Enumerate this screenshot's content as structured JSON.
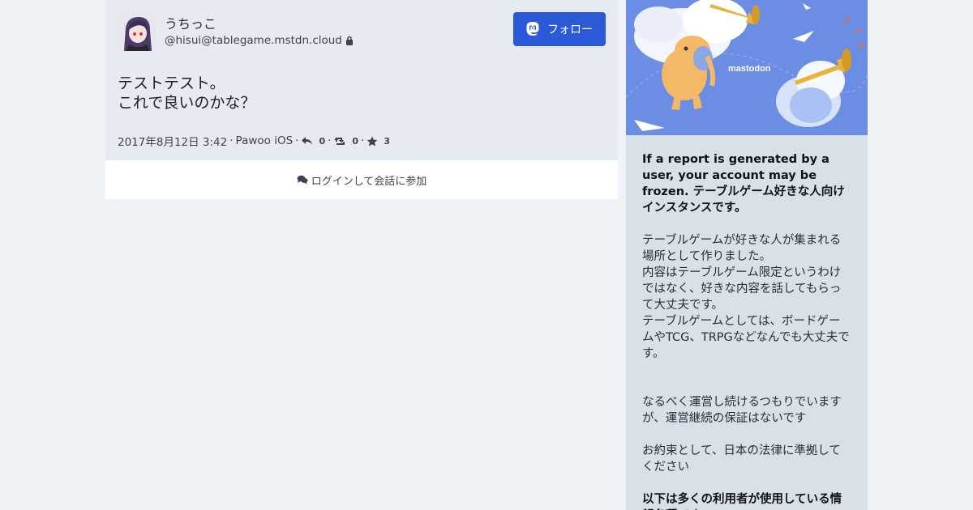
{
  "status": {
    "display_name": "うちっこ",
    "acct": "@hisui@tablegame.mstdn.cloud",
    "follow_label": "フォロー",
    "content_lines": [
      "テストテスト。",
      "これで良いのかな？"
    ],
    "date": "2017年8月12日 3:42",
    "application": "Pawoo iOS",
    "replies": "0",
    "reblogs": "0",
    "favourites": "3",
    "separator": "·"
  },
  "login": {
    "label": "ログインして会話に参加"
  },
  "hero": {
    "brand": "mastodon"
  },
  "about": {
    "heading": "If a report is generated by a user, your account may be frozen. テーブルゲーム好きな人向けインスタンスです。",
    "para1": "テーブルゲームが好きな人が集まれる場所として作りました。\n内容はテーブルゲーム限定というわけではなく、好きな内容を話してもらって大丈夫です。\nテーブルゲームとしては、ボードゲームやTCG、TRPGなどなんでも大丈夫です。",
    "para2": "なるべく運営し続けるつもりでいますが、運営継続の保証はないです",
    "para3": "お約束として、日本の法律に準拠してください",
    "heading2": "以下は多くの利用者が使用している情報各種です。"
  },
  "colors": {
    "accent": "#2c59d8",
    "background": "#eff3f8",
    "sidebar": "#d9e1e8"
  }
}
